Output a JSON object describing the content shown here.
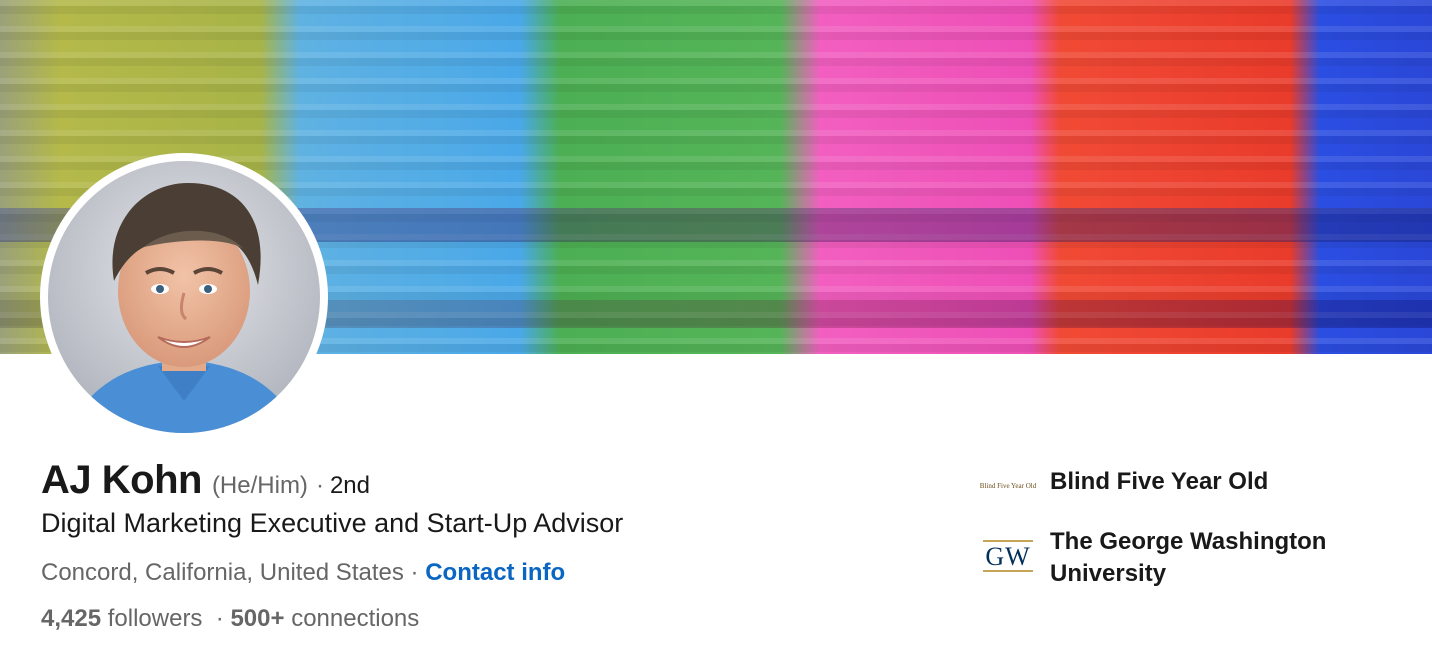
{
  "profile": {
    "name": "AJ Kohn",
    "pronouns": "(He/Him)",
    "separator": "·",
    "degree": "2nd",
    "headline": "Digital Marketing Executive and Start-Up Advisor",
    "location": "Concord, California, United States",
    "contact_label": "Contact info",
    "followers_count": "4,425",
    "followers_label": "followers",
    "connections_count": "500+",
    "connections_label": "connections"
  },
  "sidebar": {
    "items": [
      {
        "label": "Blind Five Year Old",
        "logo_text": "Blind Five Year Old"
      },
      {
        "label": "The George Washington University",
        "logo_text": "GW"
      }
    ]
  },
  "colors": {
    "link": "#0a66c2",
    "text_primary": "#191919",
    "text_secondary": "#666666",
    "gw_blue": "#02305c",
    "gw_gold": "#c5a455"
  },
  "icons": {
    "avatar": "profile-photo",
    "banner": "tv-color-bars-banner"
  }
}
